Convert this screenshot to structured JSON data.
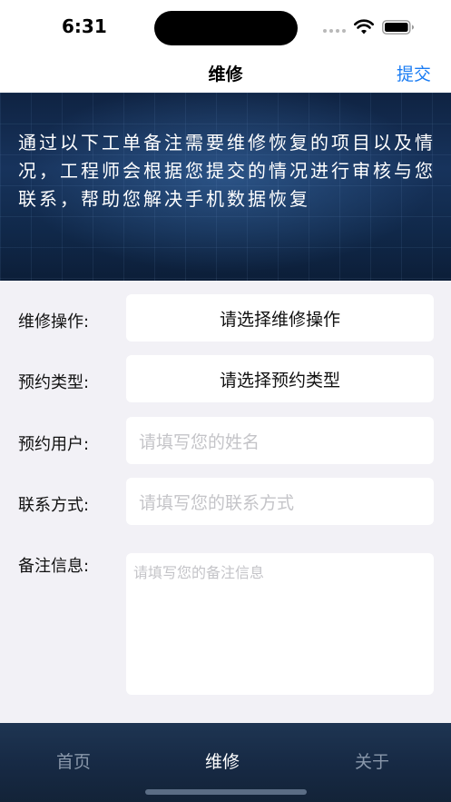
{
  "status_bar": {
    "time": "6:31",
    "icons": [
      "signal-dots-icon",
      "wifi-icon",
      "battery-icon"
    ]
  },
  "nav": {
    "title": "维修",
    "submit_label": "提交",
    "accent_color": "#1a7cf3"
  },
  "banner": {
    "text": "通过以下工单备注需要维修恢复的项目以及情况，工程师会根据您提交的情况进行审核与您联系，帮助您解决手机数据恢复"
  },
  "form": {
    "repair_operation": {
      "label": "维修操作:",
      "value": "请选择维修操作"
    },
    "appointment_type": {
      "label": "预约类型:",
      "value": "请选择预约类型"
    },
    "appointment_user": {
      "label": "预约用户:",
      "placeholder": "请填写您的姓名"
    },
    "contact": {
      "label": "联系方式:",
      "placeholder": "请填写您的联系方式"
    },
    "remarks": {
      "label": "备注信息:",
      "placeholder": "请填写您的备注信息"
    }
  },
  "tabs": [
    {
      "label": "首页",
      "active": false
    },
    {
      "label": "维修",
      "active": true
    },
    {
      "label": "关于",
      "active": false
    }
  ]
}
